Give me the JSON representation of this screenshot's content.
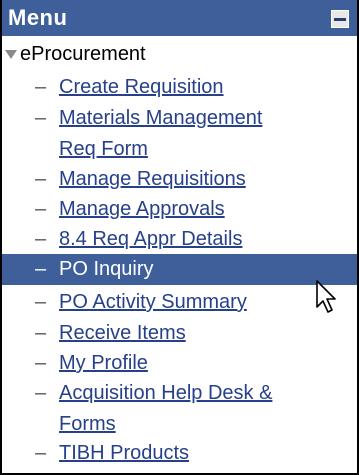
{
  "menu": {
    "title": "Menu",
    "collapse_icon": "minus-icon",
    "section": {
      "label": "eProcurement",
      "icon": "triangle-down-icon"
    },
    "items": [
      {
        "label": "Create Requisition",
        "selected": false
      },
      {
        "label": "Materials Management",
        "label_line2": "Req Form",
        "selected": false
      },
      {
        "label": "Manage Requisitions",
        "selected": false
      },
      {
        "label": "Manage Approvals",
        "selected": false
      },
      {
        "label": "8.4 Req Appr Details",
        "selected": false
      },
      {
        "label": "PO Inquiry",
        "selected": true
      },
      {
        "label": "PO Activity Summary",
        "selected": false
      },
      {
        "label": "Receive Items",
        "selected": false
      },
      {
        "label": "My Profile",
        "selected": false
      },
      {
        "label": "Acquisition Help Desk &",
        "label_line2": "Forms",
        "selected": false
      },
      {
        "label": "TIBH Products",
        "selected": false
      }
    ],
    "dash_glyph": "–",
    "colors": {
      "header_bg": "#3f5f9b",
      "link": "#27408b",
      "selected_bg": "#3f5f9b"
    }
  }
}
